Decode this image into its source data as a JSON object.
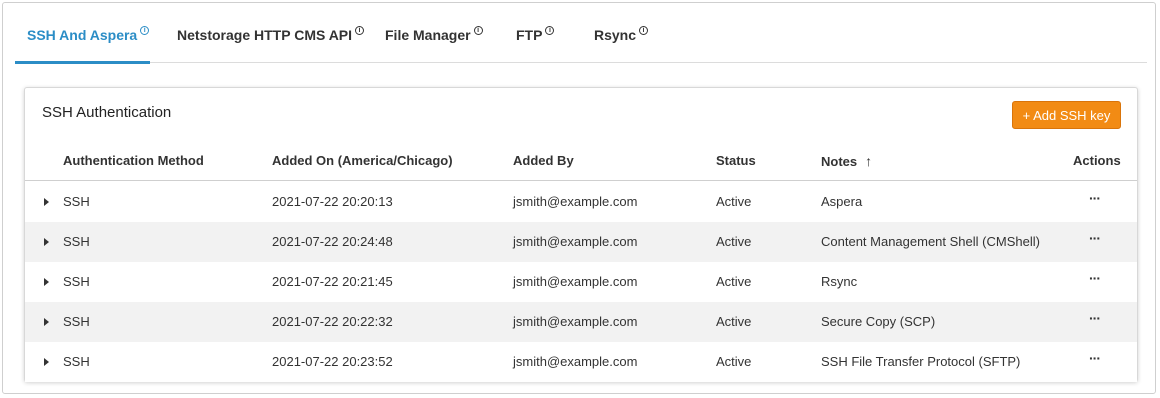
{
  "tabs": [
    {
      "label": "SSH And Aspera",
      "active": true
    },
    {
      "label": "Netstorage HTTP CMS API",
      "active": false
    },
    {
      "label": "File Manager",
      "active": false
    },
    {
      "label": "FTP",
      "active": false
    },
    {
      "label": "Rsync",
      "active": false
    }
  ],
  "info_glyph": "i",
  "card": {
    "title": "SSH Authentication",
    "add_button": "+ Add SSH key"
  },
  "table": {
    "columns": [
      "Authentication Method",
      "Added On (America/Chicago)",
      "Added By",
      "Status",
      "Notes",
      "Actions"
    ],
    "sort_indicator": "↑",
    "rows": [
      {
        "method": "SSH",
        "added_on": "2021-07-22 20:20:13",
        "added_by": "jsmith@example.com",
        "status": "Active",
        "notes": "Aspera",
        "actions": "···"
      },
      {
        "method": "SSH",
        "added_on": "2021-07-22 20:24:48",
        "added_by": "jsmith@example.com",
        "status": "Active",
        "notes": "Content Management Shell (CMShell)",
        "actions": "···"
      },
      {
        "method": "SSH",
        "added_on": "2021-07-22 20:21:45",
        "added_by": "jsmith@example.com",
        "status": "Active",
        "notes": "Rsync",
        "actions": "···"
      },
      {
        "method": "SSH",
        "added_on": "2021-07-22 20:22:32",
        "added_by": "jsmith@example.com",
        "status": "Active",
        "notes": "Secure Copy (SCP)",
        "actions": "···"
      },
      {
        "method": "SSH",
        "added_on": "2021-07-22 20:23:52",
        "added_by": "jsmith@example.com",
        "status": "Active",
        "notes": "SSH File Transfer Protocol (SFTP)",
        "actions": "···"
      }
    ]
  },
  "colors": {
    "accent": "#2b8dc6",
    "button": "#f28b14",
    "row_alt": "#f2f2f2"
  }
}
